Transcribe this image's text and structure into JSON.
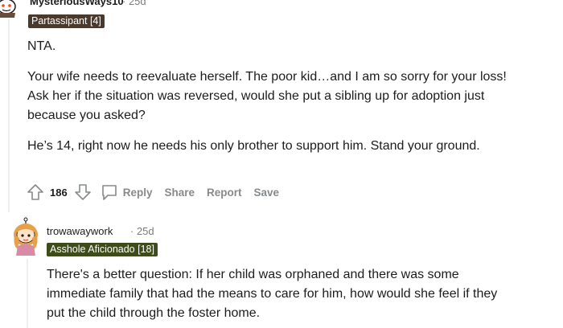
{
  "comments": [
    {
      "username": "MysteriousWays10",
      "age": "25d",
      "flair": "Partassipant [4]",
      "paragraphs": [
        "NTA.",
        "Your wife needs to reevaluate herself. The poor kid…and I am so sorry for your loss!",
        "Ask her if the situation was reversed, would she put a sibling up for adoption just",
        "because you asked?",
        "He’s 14, right now he needs his only brother to support him. Stand your ground."
      ],
      "votes": "186",
      "actions": {
        "reply": "Reply",
        "share": "Share",
        "report": "Report",
        "save": "Save"
      }
    },
    {
      "username": "trowawaywork",
      "age": "25d",
      "flair": "Asshole Aficionado [18]",
      "lines": [
        "There's a better question: If her child was orphaned and there was some",
        "immediate family that had the means to care for him, how would she feel if they",
        "put the child through the foster home."
      ]
    }
  ],
  "colors": {
    "flair1_bg": "#4a3a2e",
    "flair2_bg": "#3e4b1a",
    "muted": "#878a8c",
    "thread_line": "#edeff1"
  },
  "icons": [
    "snoo-avatar-icon",
    "upvote-arrow-icon",
    "downvote-arrow-icon",
    "reply-bubble-icon",
    "girl-avatar-icon"
  ]
}
